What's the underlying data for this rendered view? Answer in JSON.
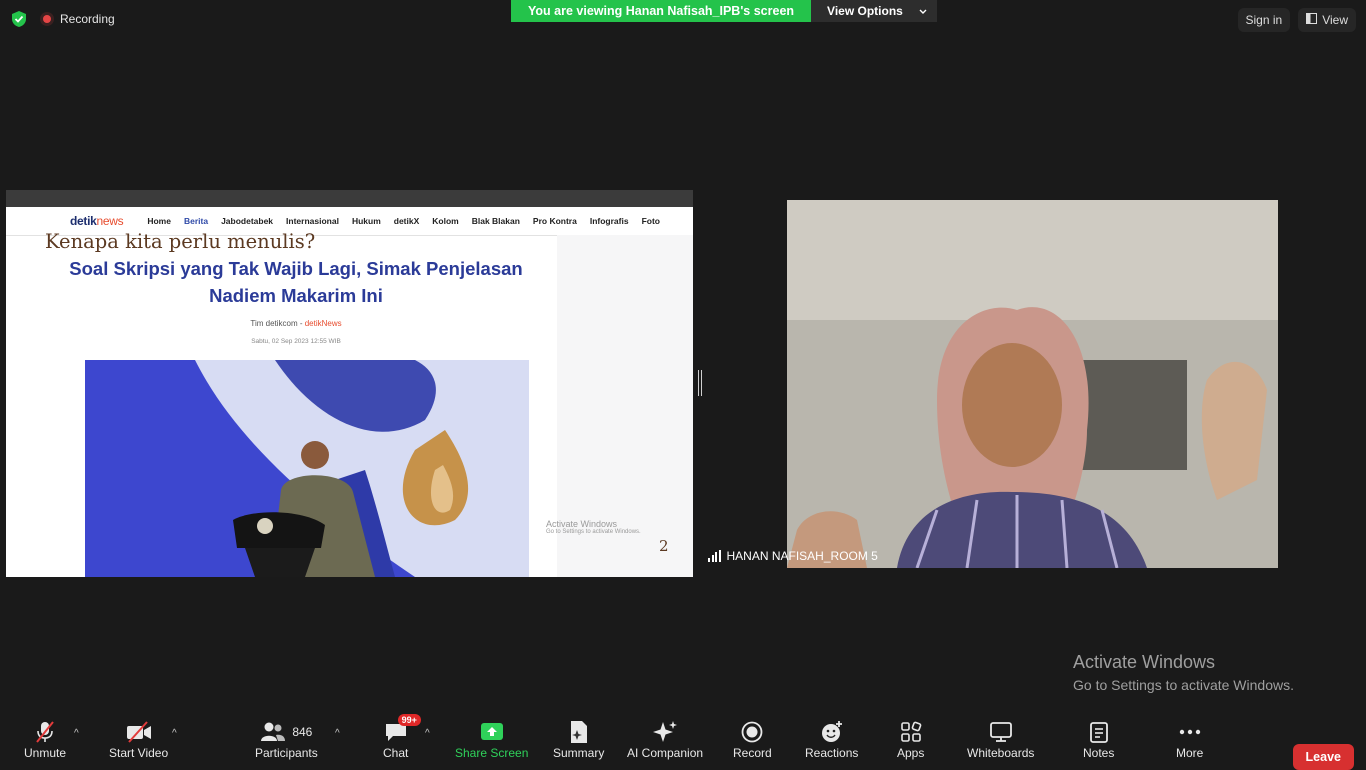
{
  "topbar": {
    "recording_label": "Recording",
    "viewing_text": "You are viewing Hanan Nafisah_IPB's screen",
    "view_options_label": "View Options",
    "sign_in_label": "Sign in",
    "view_label": "View"
  },
  "shared_screen": {
    "site": {
      "logo_primary": "detik",
      "logo_secondary": "news",
      "nav_items": [
        "Home",
        "Berita",
        "Jabodetabek",
        "Internasional",
        "Hukum",
        "detikX",
        "Kolom",
        "Blak Blakan",
        "Pro Kontra",
        "Infografis",
        "Foto"
      ]
    },
    "slide_title": "Kenapa kita perlu menulis?",
    "headline": "Soal Skripsi yang Tak Wajib Lagi, Simak Penjelasan Nadiem Makarim Ini",
    "byline_author": "Tim detikcom - ",
    "byline_source": "detikNews",
    "dateline": "Sabtu, 02 Sep 2023 12:55 WIB",
    "activate_small_title": "Activate Windows",
    "activate_small_sub": "Go to Settings to activate Windows.",
    "slide_number": "2"
  },
  "participant_tile": {
    "name": "HANAN NAFISAH_ROOM 5"
  },
  "watermark": {
    "title": "Activate Windows",
    "subtitle": "Go to Settings to activate Windows."
  },
  "toolbar": {
    "unmute": "Unmute",
    "start_video": "Start Video",
    "participants": "Participants",
    "participants_count": "846",
    "chat": "Chat",
    "chat_badge": "99+",
    "share_screen": "Share Screen",
    "summary": "Summary",
    "ai_companion": "AI Companion",
    "record": "Record",
    "reactions": "Reactions",
    "apps": "Apps",
    "whiteboards": "Whiteboards",
    "notes": "Notes",
    "more": "More",
    "leave": "Leave"
  },
  "colors": {
    "banner_green": "#24c34b",
    "leave_red": "#d73030",
    "share_green": "#2fd15a",
    "headline_blue": "#2b3b98"
  }
}
